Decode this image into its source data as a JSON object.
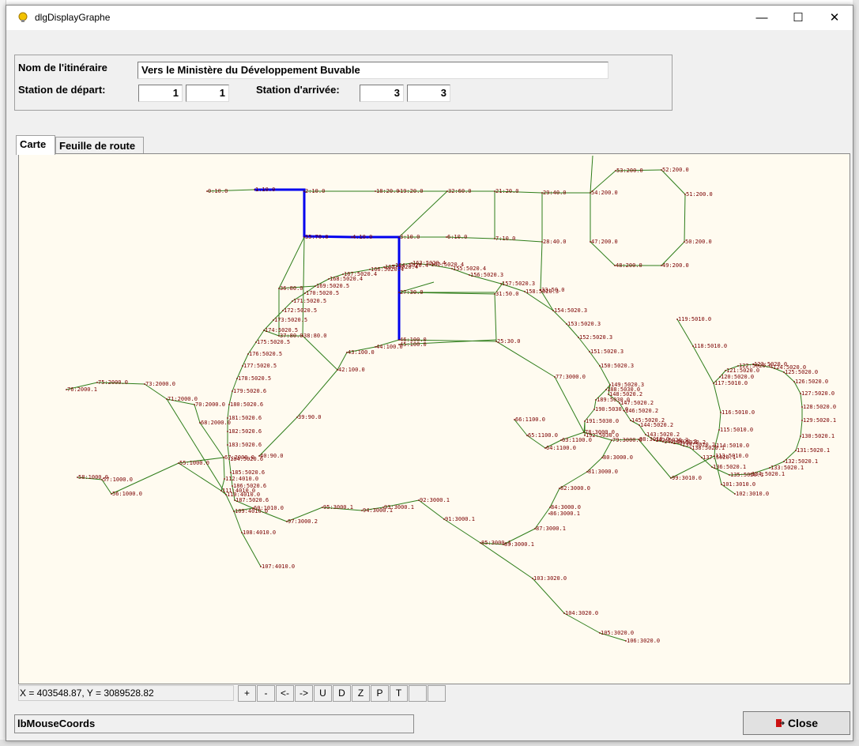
{
  "window": {
    "title": "dlgDisplayGraphe",
    "minimize_glyph": "—",
    "maximize_glyph": "☐",
    "close_glyph": "✕"
  },
  "form": {
    "route_name_label": "Nom de l'itinéraire",
    "route_name_value": "Vers le Ministère du Développement Buvable",
    "departure_label": "Station de départ:",
    "departure_values": [
      "1",
      "1"
    ],
    "arrival_label": "Station d'arrivée:",
    "arrival_values": [
      "3",
      "3"
    ]
  },
  "tabs": [
    {
      "label": "Carte",
      "selected": true
    },
    {
      "label": "Feuille de route",
      "selected": false
    }
  ],
  "map": {
    "edge_color": "#2e7d1a",
    "route_color": "#0000ee",
    "label_color": "#7a0000",
    "background": "#fffbf0",
    "nodes": [
      {
        "id": "n0",
        "label": "0:10.0"
      },
      {
        "id": "n1",
        "label": "1:10.0"
      },
      {
        "id": "n2",
        "label": "2:10.0"
      },
      {
        "id": "n18",
        "label": "18:20.0"
      },
      {
        "id": "n19",
        "label": "19:20.0"
      },
      {
        "id": "n32",
        "label": "32:60.0"
      },
      {
        "id": "n21",
        "label": "21:20.0"
      },
      {
        "id": "n29",
        "label": "29:40.0"
      },
      {
        "id": "n54",
        "label": "54:200.0"
      },
      {
        "id": "n53",
        "label": "53:200.0"
      },
      {
        "id": "n52",
        "label": "52:200.0"
      },
      {
        "id": "n51",
        "label": "51:200.0"
      },
      {
        "id": "n50",
        "label": "50:200.0"
      },
      {
        "id": "n49",
        "label": "49:200.0"
      },
      {
        "id": "n48",
        "label": "48:200.0"
      },
      {
        "id": "n47",
        "label": "47:200.0"
      },
      {
        "id": "n35",
        "label": "35:70.0"
      },
      {
        "id": "n4",
        "label": "4:10.0"
      },
      {
        "id": "n3",
        "label": "3:10.0"
      },
      {
        "id": "n6",
        "label": "6:10.0"
      },
      {
        "id": "n7",
        "label": "7:10.0"
      },
      {
        "id": "n28",
        "label": "28:40.0"
      },
      {
        "id": "n27",
        "label": "27:30.0"
      },
      {
        "id": "n31",
        "label": "31:50.0"
      },
      {
        "id": "n46",
        "label": "46:100.0"
      },
      {
        "id": "n45",
        "label": "45:100.0"
      },
      {
        "id": "n44",
        "label": "44:100.0"
      },
      {
        "id": "n25",
        "label": "25:30.0"
      },
      {
        "id": "n43",
        "label": "43:100.0"
      },
      {
        "id": "n42",
        "label": "42:100.0"
      },
      {
        "id": "n39",
        "label": "39:90.0"
      },
      {
        "id": "n40",
        "label": "40:90.0"
      },
      {
        "id": "n36",
        "label": "36:80.0"
      },
      {
        "id": "n37",
        "label": "37:80.0"
      },
      {
        "id": "n38",
        "label": "38:80.0"
      },
      {
        "id": "n164",
        "label": "164:5020.4"
      },
      {
        "id": "n165",
        "label": "165:5020.4"
      },
      {
        "id": "n166",
        "label": "166:5020.4"
      },
      {
        "id": "n167",
        "label": "167:5020.4"
      },
      {
        "id": "n168",
        "label": "168:5020.4"
      },
      {
        "id": "n169",
        "label": "169:5020.5"
      },
      {
        "id": "n170",
        "label": "170:5020.5"
      },
      {
        "id": "n171",
        "label": "171:5020.5"
      },
      {
        "id": "n172",
        "label": "172:5020.5"
      },
      {
        "id": "n173",
        "label": "173:5020.5"
      },
      {
        "id": "n174",
        "label": "174:5020.5"
      },
      {
        "id": "n175",
        "label": "175:5020.5"
      },
      {
        "id": "n176",
        "label": "176:5020.5"
      },
      {
        "id": "n177",
        "label": "177:5020.5"
      },
      {
        "id": "n178",
        "label": "178:5020.5"
      },
      {
        "id": "n179",
        "label": "179:5020.6"
      },
      {
        "id": "n180",
        "label": "180:5020.6"
      },
      {
        "id": "n181",
        "label": "181:5020.6"
      },
      {
        "id": "n182",
        "label": "182:5020.6"
      },
      {
        "id": "n183",
        "label": "183:5020.6"
      },
      {
        "id": "n184",
        "label": "184:5020.6"
      },
      {
        "id": "n185",
        "label": "185:5020.6"
      },
      {
        "id": "n186",
        "label": "186:5020.6"
      },
      {
        "id": "n187",
        "label": "187:5020.6"
      },
      {
        "id": "n163",
        "label": "163:5020.4"
      },
      {
        "id": "n162",
        "label": "162:5020.4"
      },
      {
        "id": "n155",
        "label": "155:5020.4"
      },
      {
        "id": "n156",
        "label": "156:5020.3"
      },
      {
        "id": "n157",
        "label": "157:5020.3"
      },
      {
        "id": "n158",
        "label": "158:5020.3"
      },
      {
        "id": "n33",
        "label": "33:50.0"
      },
      {
        "id": "n154",
        "label": "154:5020.3"
      },
      {
        "id": "n153",
        "label": "153:5020.3"
      },
      {
        "id": "n152",
        "label": "152:5020.3"
      },
      {
        "id": "n151",
        "label": "151:5020.3"
      },
      {
        "id": "n150",
        "label": "150:5020.3"
      },
      {
        "id": "n149",
        "label": "149:5020.3"
      },
      {
        "id": "n188",
        "label": "188:5030.0"
      },
      {
        "id": "n189",
        "label": "189:5030.0"
      },
      {
        "id": "n190",
        "label": "190:5030.0"
      },
      {
        "id": "n191",
        "label": "191:5030.0"
      },
      {
        "id": "n192",
        "label": "192:5030.0"
      },
      {
        "id": "n148",
        "label": "148:5020.2"
      },
      {
        "id": "n147",
        "label": "147:5020.2"
      },
      {
        "id": "n146",
        "label": "146:5020.2"
      },
      {
        "id": "n145",
        "label": "145:5020.2"
      },
      {
        "id": "n144",
        "label": "144:5020.2"
      },
      {
        "id": "n143",
        "label": "143:5020.2"
      },
      {
        "id": "n142",
        "label": "142:5020.2"
      },
      {
        "id": "n141",
        "label": "141:5020.2"
      },
      {
        "id": "n140",
        "label": "140:5020.2"
      },
      {
        "id": "n139",
        "label": "139:5020.2"
      },
      {
        "id": "n138",
        "label": "138:5020.1"
      },
      {
        "id": "n137",
        "label": "137:5020.1"
      },
      {
        "id": "n136",
        "label": "136:5020.1"
      },
      {
        "id": "n135",
        "label": "135:5020.1"
      },
      {
        "id": "n134",
        "label": "134:5020.1"
      },
      {
        "id": "n133",
        "label": "133:5020.1"
      },
      {
        "id": "n132",
        "label": "132:5020.1"
      },
      {
        "id": "n131",
        "label": "131:5020.1"
      },
      {
        "id": "n130",
        "label": "130:5020.1"
      },
      {
        "id": "n129",
        "label": "129:5020.1"
      },
      {
        "id": "n128",
        "label": "128:5020.0"
      },
      {
        "id": "n127",
        "label": "127:5020.0"
      },
      {
        "id": "n126",
        "label": "126:5020.0"
      },
      {
        "id": "n125",
        "label": "125:5020.0"
      },
      {
        "id": "n124",
        "label": "124:5020.0"
      },
      {
        "id": "n123",
        "label": "123:5020.0"
      },
      {
        "id": "n122",
        "label": "122:5020.0"
      },
      {
        "id": "n121",
        "label": "121:5020.0"
      },
      {
        "id": "n120",
        "label": "120:5020.0"
      },
      {
        "id": "n119",
        "label": "119:5010.0"
      },
      {
        "id": "n118",
        "label": "118:5010.0"
      },
      {
        "id": "n117",
        "label": "117:5010.0"
      },
      {
        "id": "n116",
        "label": "116:5010.0"
      },
      {
        "id": "n115",
        "label": "115:5010.0"
      },
      {
        "id": "n114",
        "label": "114:5010.0"
      },
      {
        "id": "n113",
        "label": "113:5010.0"
      },
      {
        "id": "n101",
        "label": "101:3010.0"
      },
      {
        "id": "n102",
        "label": "102:3010.0"
      },
      {
        "id": "n99",
        "label": "99:3010.0"
      },
      {
        "id": "n98",
        "label": "98:3010.0"
      },
      {
        "id": "n77",
        "label": "77:3000.0"
      },
      {
        "id": "n78",
        "label": "78:3000.0"
      },
      {
        "id": "n79",
        "label": "79:3000.0"
      },
      {
        "id": "n80",
        "label": "80:3000.0"
      },
      {
        "id": "n81",
        "label": "81:3000.0"
      },
      {
        "id": "n82",
        "label": "82:3000.0"
      },
      {
        "id": "n84",
        "label": "84:3000.0"
      },
      {
        "id": "n86",
        "label": "86:3000.1"
      },
      {
        "id": "n87",
        "label": "87:3000.1"
      },
      {
        "id": "n85",
        "label": "85:3000.1"
      },
      {
        "id": "n89",
        "label": "89:3000.1"
      },
      {
        "id": "n91",
        "label": "91:3000.1"
      },
      {
        "id": "n92",
        "label": "92:3000.1"
      },
      {
        "id": "n93",
        "label": "93:3000.1"
      },
      {
        "id": "n94",
        "label": "94:3000.1"
      },
      {
        "id": "n95",
        "label": "95:3000.1"
      },
      {
        "id": "n97",
        "label": "97:3000.2"
      },
      {
        "id": "n103",
        "label": "103:3020.0"
      },
      {
        "id": "n104",
        "label": "104:3020.0"
      },
      {
        "id": "n105",
        "label": "105:3020.0"
      },
      {
        "id": "n106",
        "label": "106:3020.0"
      },
      {
        "id": "n63",
        "label": "63:1100.0"
      },
      {
        "id": "n64",
        "label": "64:1100.0"
      },
      {
        "id": "n65",
        "label": "65:1100.0"
      },
      {
        "id": "n66",
        "label": "66:1100.0"
      },
      {
        "id": "n76",
        "label": "76:2000.1"
      },
      {
        "id": "n75",
        "label": "75:2000.0"
      },
      {
        "id": "n73",
        "label": "73:2000.0"
      },
      {
        "id": "n71",
        "label": "71:2000.0"
      },
      {
        "id": "n70",
        "label": "70:2000.0"
      },
      {
        "id": "n68",
        "label": "68:2000.0"
      },
      {
        "id": "n67",
        "label": "67:2000.0"
      },
      {
        "id": "n55",
        "label": "55:1000.0"
      },
      {
        "id": "n56",
        "label": "56:1000.0"
      },
      {
        "id": "n58",
        "label": "58:1000.0"
      },
      {
        "id": "n57",
        "label": "57:1000.0"
      },
      {
        "id": "n112",
        "label": "112:4010.0"
      },
      {
        "id": "n111",
        "label": "111:4010.0"
      },
      {
        "id": "n110",
        "label": "110:4010.0"
      },
      {
        "id": "n109",
        "label": "109:4010.0"
      },
      {
        "id": "n108",
        "label": "108:4010.0"
      },
      {
        "id": "n107",
        "label": "107:4010.0"
      },
      {
        "id": "n60",
        "label": "60:1010.0"
      }
    ]
  },
  "zoom_controls": [
    "+",
    "-",
    "<-",
    "->",
    "U",
    "D",
    "Z",
    "P",
    "T",
    "",
    ""
  ],
  "status": {
    "mouse_coords": "X = 403548.87, Y = 3089528.82",
    "lb_mouse_coords": "lbMouseCoords"
  },
  "close_button": {
    "label": "Close"
  }
}
